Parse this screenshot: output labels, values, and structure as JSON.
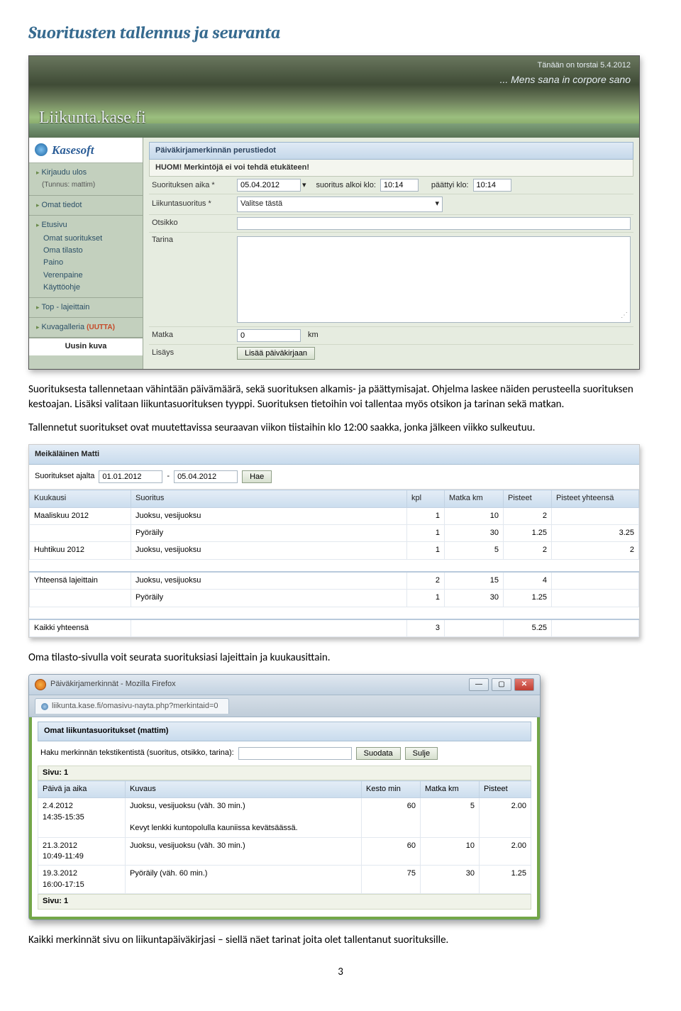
{
  "doc": {
    "heading": "Suoritusten tallennus ja seuranta",
    "para1": "Suorituksesta tallennetaan vähintään päivämäärä, sekä suorituksen alkamis- ja päättymisajat. Ohjelma laskee näiden perusteella suorituksen kestoajan. Lisäksi valitaan liikuntasuorituksen tyyppi. Suorituksen tietoihin voi tallentaa myös otsikon ja tarinan sekä matkan.",
    "para2": "Tallennetut suoritukset ovat muutettavissa seuraavan viikon tiistaihin klo 12:00 saakka, jonka jälkeen viikko sulkeutuu.",
    "para3": "Oma tilasto-sivulla voit seurata suorituksiasi lajeittain ja kuukausittain.",
    "para4": "Kaikki merkinnät sivu on liikuntapäiväkirjasi – siellä näet tarinat joita olet tallentanut suorituksille.",
    "pagenum": "3"
  },
  "s1": {
    "date": "Tänään on torstai 5.4.2012",
    "motto": "... Mens sana in corpore sano",
    "site": "Liikunta.kase.fi",
    "logo": "Kasesoft",
    "nav": {
      "logout": "Kirjaudu ulos",
      "tunnus": "(Tunnus: mattim)",
      "omat": "Omat tiedot",
      "etusivu": "Etusivu",
      "sub": [
        "Omat suoritukset",
        "Oma tilasto",
        "Paino",
        "Verenpaine",
        "Käyttöohje"
      ],
      "top": "Top - lajeittain",
      "kuva": "Kuvagalleria",
      "uutta": "(UUTTA)",
      "uusin": "Uusin kuva"
    },
    "panel": "Päiväkirjamerkinnän perustiedot",
    "huom": "HUOM! Merkintöjä ei voi tehdä etukäteen!",
    "rows": {
      "aika_lbl": "Suorituksen aika *",
      "aika_val": "05.04.2012",
      "alkoi_lbl": "suoritus alkoi klo:",
      "alkoi_val": "10:14",
      "paattyi_lbl": "päättyi klo:",
      "paattyi_val": "10:14",
      "suoritus_lbl": "Liikuntasuoritus *",
      "suoritus_val": "Valitse tästä",
      "otsikko_lbl": "Otsikko",
      "tarina_lbl": "Tarina",
      "matka_lbl": "Matka",
      "matka_val": "0",
      "matka_unit": "km",
      "lisays_lbl": "Lisäys",
      "lisaa_btn": "Lisää päiväkirjaan"
    }
  },
  "s2": {
    "name": "Meikäläinen Matti",
    "filter_lbl": "Suoritukset ajalta",
    "from": "01.01.2012",
    "to": "05.04.2012",
    "hae": "Hae",
    "cols": [
      "Kuukausi",
      "Suoritus",
      "kpl",
      "Matka km",
      "Pisteet",
      "Pisteet yhteensä"
    ],
    "rows": [
      [
        "Maaliskuu 2012",
        "Juoksu, vesijuoksu",
        "1",
        "10",
        "2",
        ""
      ],
      [
        "",
        "Pyöräily",
        "1",
        "30",
        "1.25",
        "3.25"
      ],
      [
        "Huhtikuu 2012",
        "Juoksu, vesijuoksu",
        "1",
        "5",
        "2",
        "2"
      ]
    ],
    "totals_label": "Yhteensä lajeittain",
    "totals": [
      [
        "Juoksu, vesijuoksu",
        "2",
        "15",
        "4"
      ],
      [
        "Pyöräily",
        "1",
        "30",
        "1.25"
      ]
    ],
    "grand_label": "Kaikki yhteensä",
    "grand": [
      "3",
      "",
      "5.25"
    ]
  },
  "s3": {
    "wintitle": "Päiväkirjamerkinnät - Mozilla Firefox",
    "url": "liikunta.kase.fi/omasivu-nayta.php?merkintaid=0",
    "panel": "Omat liikuntasuoritukset (mattim)",
    "filter_lbl": "Haku merkinnän tekstikentistä (suoritus, otsikko, tarina):",
    "suodata": "Suodata",
    "sulje": "Sulje",
    "sivu": "Sivu: 1",
    "cols": [
      "Päivä ja aika",
      "Kuvaus",
      "Kesto min",
      "Matka km",
      "Pisteet"
    ],
    "rows": [
      {
        "d": "2.4.2012\n14:35-15:35",
        "k": "Juoksu, vesijuoksu (väh. 30 min.)\n\nKevyt lenkki kuntopolulla kauniissa kevätsäässä.",
        "min": "60",
        "mat": "5",
        "p": "2.00"
      },
      {
        "d": "21.3.2012\n10:49-11:49",
        "k": "Juoksu, vesijuoksu (väh. 30 min.)",
        "min": "60",
        "mat": "10",
        "p": "2.00"
      },
      {
        "d": "19.3.2012\n16:00-17:15",
        "k": "Pyöräily (väh. 60 min.)",
        "min": "75",
        "mat": "30",
        "p": "1.25"
      }
    ]
  }
}
